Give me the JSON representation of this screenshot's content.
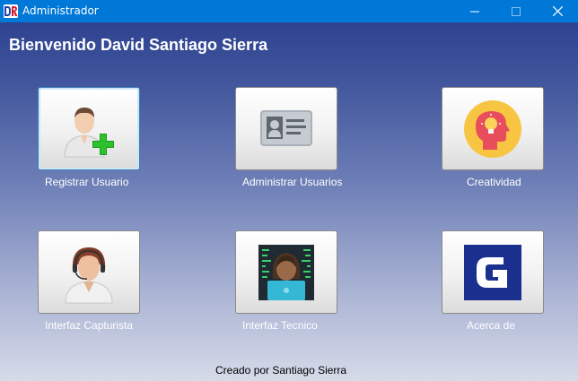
{
  "window": {
    "title": "Administrador",
    "icon": "app-logo-icon",
    "controls": [
      "minimize-icon",
      "maximize-icon",
      "close-icon"
    ]
  },
  "main": {
    "welcome": "Bienvenido David Santiago Sierra",
    "tiles": [
      {
        "label": "Registrar Usuario",
        "icon": "add-user-icon"
      },
      {
        "label": "Administrar Usuarios",
        "icon": "id-card-icon"
      },
      {
        "label": "Creatividad",
        "icon": "creativity-head-icon"
      },
      {
        "label": "Interfaz Capturista",
        "icon": "operator-headset-icon"
      },
      {
        "label": "Interfaz Tecnico",
        "icon": "technician-laptop-icon"
      },
      {
        "label": "Acerca de",
        "icon": "logo-g-icon"
      }
    ]
  },
  "footer": {
    "credit": "Creado por Santiago Sierra"
  },
  "colors": {
    "titlebar": "#0078d7",
    "background_top": "#2e4290",
    "background_bottom": "#d6dbe9"
  }
}
